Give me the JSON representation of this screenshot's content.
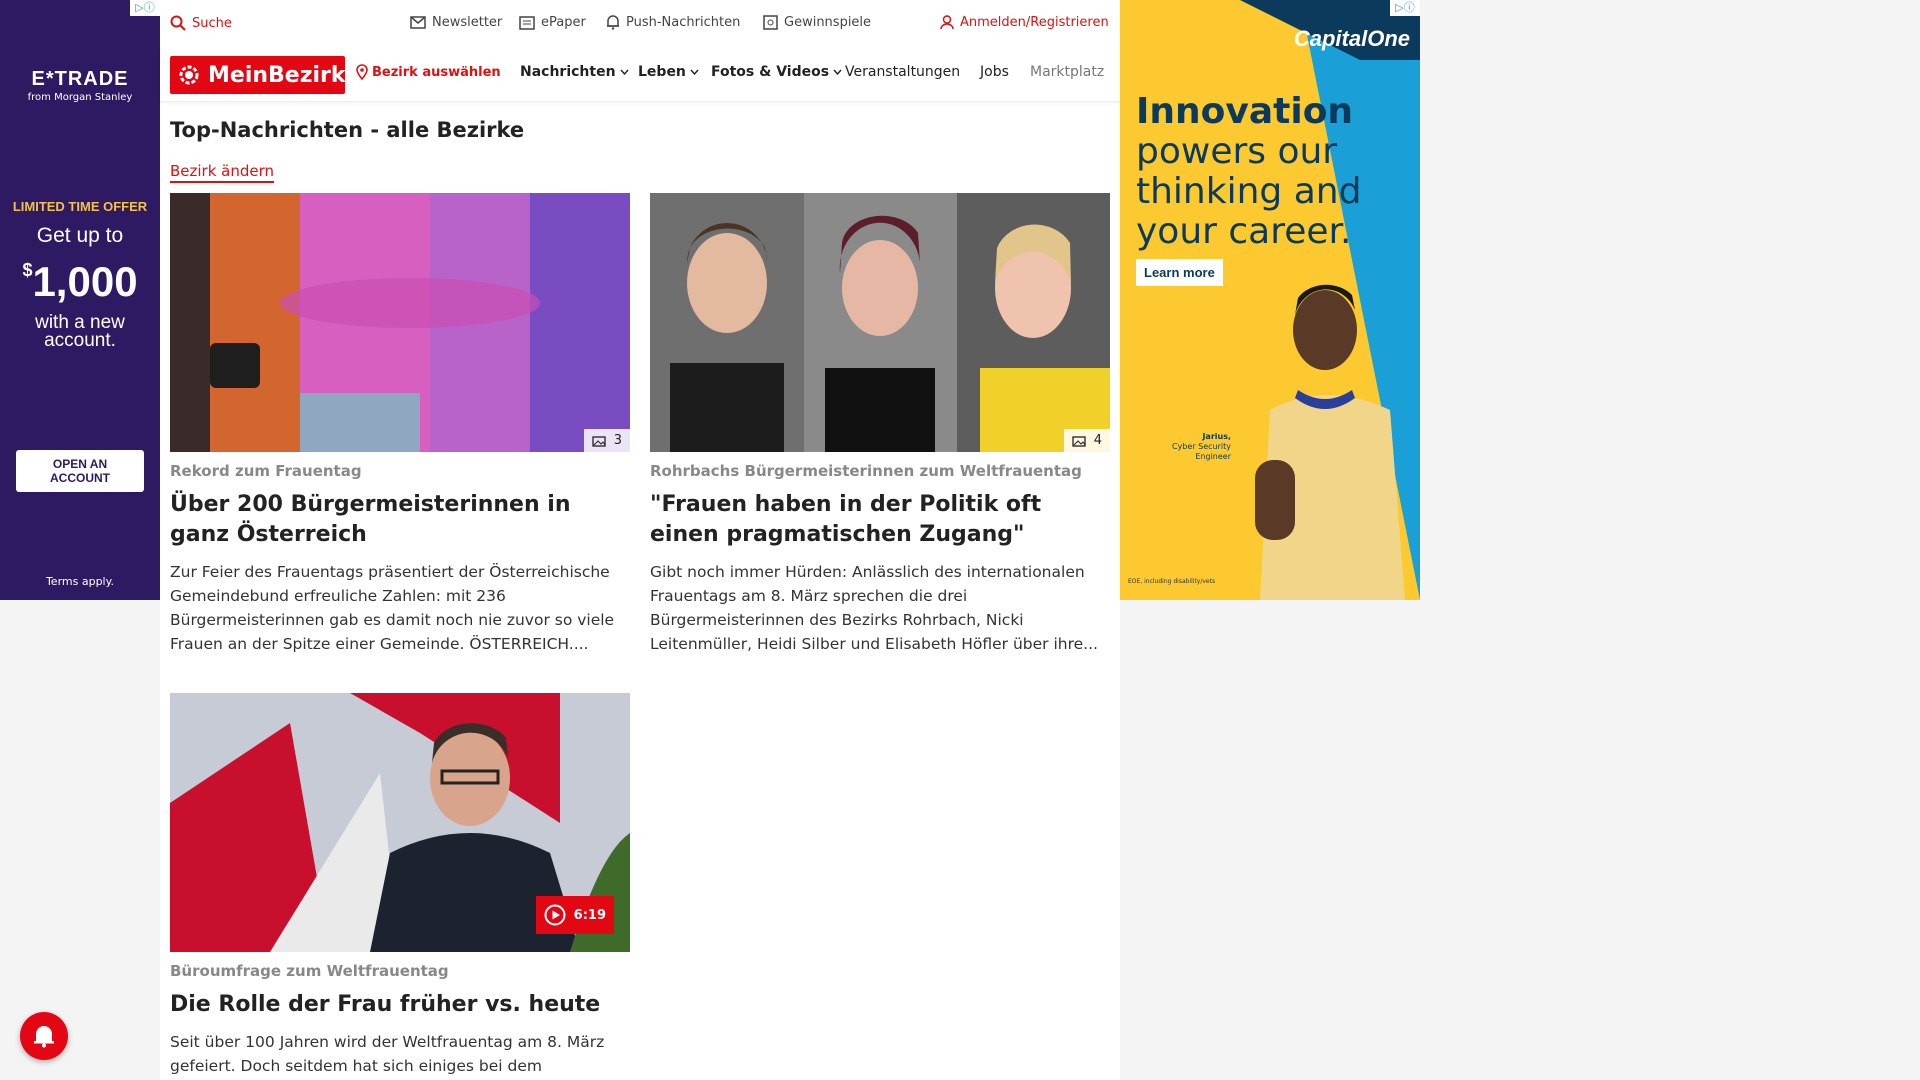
{
  "ad_left": {
    "brand": "E*TRADE",
    "brand_sub": "from Morgan Stanley",
    "offer": "LIMITED TIME OFFER",
    "get": "Get up to",
    "currency": "$",
    "amount": "1,000",
    "with_new": "with a new account.",
    "cta": "OPEN AN ACCOUNT",
    "terms": "Terms apply.",
    "bg_color": "#2d1a63"
  },
  "ad_right": {
    "brand": "CapitalOne",
    "headline_bold": "Innovation",
    "headline_rest": "powers our thinking and your career.",
    "cta": "Learn more",
    "person_name": "Jarius,",
    "person_title": "Cyber Security Engineer",
    "fine_print": "EOE, including disability/vets"
  },
  "topbar": {
    "search": "Suche",
    "newsletter": "Newsletter",
    "epaper": "ePaper",
    "push": "Push-Nachrichten",
    "contests": "Gewinnspiele",
    "login": "Anmelden/Registrieren"
  },
  "navbar": {
    "logo": "MeinBezirk",
    "select_district": "Bezirk auswählen",
    "items": [
      "Nachrichten",
      "Leben",
      "Fotos & Videos",
      "Veranstaltungen",
      "Jobs",
      "Marktplatz"
    ]
  },
  "page": {
    "title": "Top-Nachrichten - alle Bezirke",
    "change_district": "Bezirk ändern"
  },
  "articles": [
    {
      "kicker": "Rekord zum Frauentag",
      "headline": "Über 200 Bürgermeisterinnen in ganz Österreich",
      "teaser": "Zur Feier des Frauentags präsentiert der Österreichische Gemeindebund erfreuliche Zahlen: mit 236 Bürgermeisterinnen gab es damit noch nie zuvor so viele Frauen an der Spitze einer Gemeinde. ÖSTERREICH....",
      "photo_count": "3"
    },
    {
      "kicker": "Rohrbachs Bürgermeisterinnen zum Weltfrauentag",
      "headline": "\"Frauen haben in der Politik oft einen pragmatischen Zugang\"",
      "teaser": "Gibt noch immer Hürden: Anlässlich des internationalen Frauentags am 8. März sprechen die drei Bürgermeisterinnen des Bezirks Rohrbach, Nicki Leitenmüller, Heidi Silber und Elisabeth Höfler über ihre...",
      "photo_count": "4"
    },
    {
      "kicker": "Büroumfrage zum Weltfrauentag",
      "headline": "Die Rolle der Frau früher vs. heute",
      "teaser": "Seit über 100 Jahren wird der Weltfrauentag am 8. März gefeiert. Doch seitdem hat sich einiges bei dem",
      "video_duration": "6:19"
    }
  ],
  "colors": {
    "brand_red": "#e30613",
    "link_red": "#dd1111"
  }
}
